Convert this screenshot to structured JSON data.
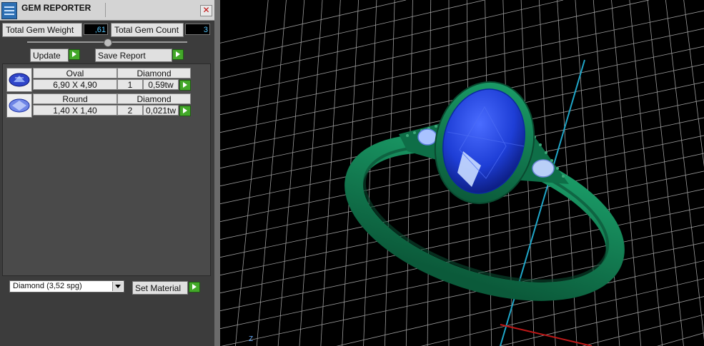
{
  "window": {
    "title": "GEM REPORTER",
    "close_glyph": "✕"
  },
  "summary": {
    "total_weight_label": "Total Gem Weight",
    "total_weight_value": ",61",
    "total_count_label": "Total Gem Count",
    "total_count_value": "3"
  },
  "buttons": {
    "update_label": "Update",
    "save_report_label": "Save Report"
  },
  "gems": [
    {
      "shape": "Oval",
      "material": "Diamond",
      "size": "6,90 X 4,90",
      "count": "1",
      "weight": "0,59tw"
    },
    {
      "shape": "Round",
      "material": "Diamond",
      "size": "1,40 X 1,40",
      "count": "2",
      "weight": "0,021tw"
    }
  ],
  "material": {
    "selected": "Diamond      (3,52 spg)",
    "set_label": "Set Material"
  },
  "viewport": {
    "axis_label": "Z"
  },
  "colors": {
    "metal": "#0f7a50",
    "stone": "#1e3ed6",
    "accent": "#43a829",
    "grid": "#d0d0d0"
  },
  "icons": [
    "app-icon",
    "close-icon",
    "go-arrow-icon",
    "oval-gem-icon",
    "round-gem-icon",
    "dropdown-arrow-icon"
  ]
}
